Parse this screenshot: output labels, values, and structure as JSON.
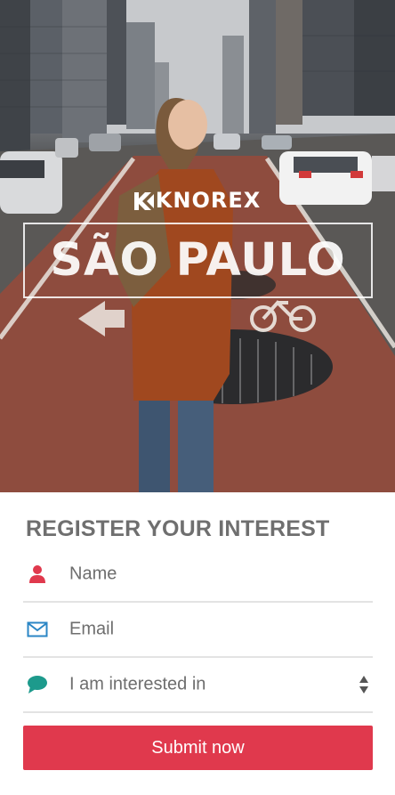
{
  "hero": {
    "brand_name": "KNOREX",
    "city_title": "SÃO PAULO"
  },
  "form": {
    "title": "REGISTER YOUR INTEREST",
    "fields": [
      {
        "label": "Name",
        "icon": "person-icon"
      },
      {
        "label": "Email",
        "icon": "envelope-icon"
      },
      {
        "label": "I am interested in",
        "icon": "chat-bubble-icon"
      }
    ],
    "submit_label": "Submit now"
  },
  "colors": {
    "accent": "#e0394d",
    "email_icon": "#2b86c5",
    "chat_icon": "#1d9a8c",
    "title_text": "#6f6f6f",
    "divider": "#e3e3e3"
  }
}
